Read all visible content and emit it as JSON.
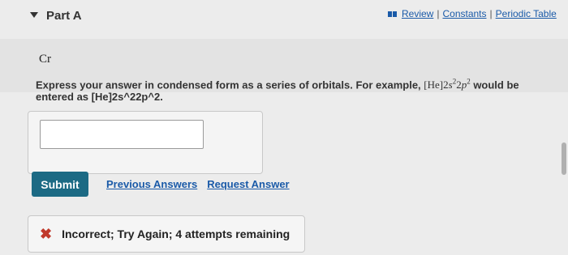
{
  "header": {
    "part_title": "Part A",
    "links": [
      "Review",
      "Constants",
      "Periodic Table"
    ],
    "separator": "|"
  },
  "question": {
    "element": "Cr",
    "instruction_prefix": "Express your answer in condensed form as a series of orbitals. For example,",
    "example_core": "[He]2",
    "example_s": "s",
    "example_exp1": "2",
    "example_mid": "2",
    "example_p": "p",
    "example_exp2": "2",
    "instruction_suffix": "would be entered as [He]2s^22p^2."
  },
  "answer": {
    "value": "",
    "placeholder": ""
  },
  "actions": {
    "submit_label": "Submit",
    "previous_answers_label": "Previous Answers",
    "request_answer_label": "Request Answer"
  },
  "feedback": {
    "icon": "x-icon",
    "message": "Incorrect; Try Again; 4 attempts remaining"
  },
  "colors": {
    "accent": "#1c6a84",
    "link": "#1a5aa8",
    "error": "#c0392b"
  }
}
